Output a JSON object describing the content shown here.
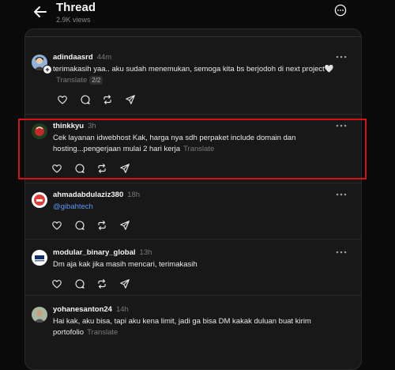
{
  "header": {
    "title": "Thread",
    "views": "2.9K views",
    "back_icon": "arrow-left-icon",
    "more_icon": "more-circle-icon"
  },
  "colors": {
    "background": "#0a0a0a",
    "panel": "#181818",
    "text": "#f3f5f7",
    "muted": "#7a7a7a",
    "mention": "#5b97f5",
    "highlight": "#d21414"
  },
  "posts": [
    {
      "username": "adindaasrd",
      "time": "44m",
      "text": "terimakasih yaa.. aku sudah menemukan, semoga kita bs berjodoh di next project🤍",
      "translate": "Translate",
      "pager": "2/2"
    },
    {
      "username": "thinkkyu",
      "time": "3h",
      "text": "Cek layanan idwebhost Kak, harga nya sdh perpaket include domain dan hosting...pengerjaan mulai 2 hari kerja",
      "translate": "Translate"
    },
    {
      "username": "ahmadabdulaziz380",
      "time": "18h",
      "mention": "@gibahtech"
    },
    {
      "username": "modular_binary_global",
      "time": "13h",
      "text": "Dm aja kak jika masih mencari, terimakasih"
    },
    {
      "username": "yohanesanton24",
      "time": "14h",
      "text": "Hai kak, aku bisa, tapi aku kena limit, jadi ga bisa DM kakak duluan buat kirim portofolio",
      "translate": "Translate"
    }
  ],
  "action_icons": [
    "heart-icon",
    "comment-icon",
    "repost-icon",
    "share-icon"
  ]
}
